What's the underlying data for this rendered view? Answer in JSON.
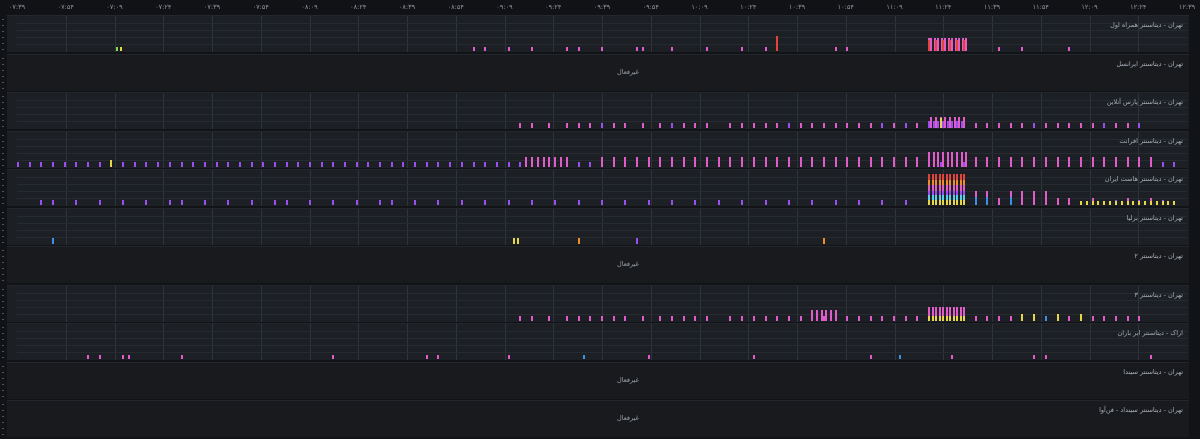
{
  "time_axis": {
    "ticks": [
      "۰۷:۳۹",
      "۰۷:۵۴",
      "۰۷:۰۹",
      "۰۷:۲۴",
      "۰۷:۳۹",
      "۰۷:۵۴",
      "۰۸:۰۹",
      "۰۸:۲۴",
      "۰۸:۳۹",
      "۰۸:۵۴",
      "۰۹:۰۹",
      "۰۹:۲۴",
      "۰۹:۳۹",
      "۰۹:۵۴",
      "۱۰:۰۹",
      "۱۰:۲۴",
      "۱۰:۳۹",
      "۱۰:۵۴",
      "۱۱:۰۹",
      "۱۱:۲۴",
      "۱۱:۳۹",
      "۱۱:۵۴",
      "۱۲:۰۹",
      "۱۲:۲۴",
      "۱۲:۳۹"
    ]
  },
  "colors": {
    "pink": "#e05cc8",
    "purple": "#9b4ff0",
    "red": "#e0443a",
    "orange": "#ef8a2d",
    "yellow": "#e7d64a",
    "green": "#7ed957",
    "blue": "#3f8fe6",
    "cyan": "#5ad0e8"
  },
  "panels": [
    {
      "title": "تهران - دیتاسنتر همراه اول",
      "status": "",
      "active": true,
      "series": [
        {
          "x": [
            0.085,
            0.088,
            0.39,
            0.4,
            0.42,
            0.44,
            0.47,
            0.48,
            0.5,
            0.53,
            0.535,
            0.56,
            0.59,
            0.62,
            0.64,
            0.7,
            0.71,
            0.84,
            0.86,
            0.9
          ],
          "h": 0.12,
          "color": "pink"
        },
        {
          "x": [
            0.085
          ],
          "h": 0.12,
          "color": "green"
        },
        {
          "x": [
            0.088
          ],
          "h": 0.12,
          "color": "yellow"
        },
        {
          "x": [
            0.65
          ],
          "h": 0.45,
          "color": "red"
        },
        {
          "x": [
            0.78,
            0.782,
            0.785,
            0.788,
            0.791,
            0.794,
            0.797,
            0.8,
            0.803,
            0.806,
            0.809,
            0.812
          ],
          "h": 0.38,
          "color": "pink"
        },
        {
          "x": [
            0.78,
            0.786,
            0.792,
            0.798,
            0.804,
            0.81
          ],
          "h": 0.32,
          "color": "red"
        }
      ]
    },
    {
      "title": "تهران - دیتاسنتر ایرانسل",
      "status": "غیرفعال",
      "active": false,
      "series": []
    },
    {
      "title": "تهران - دیتاسنتر پارس آنلاین",
      "status": "",
      "active": true,
      "series": [
        {
          "x": [
            0.43,
            0.44,
            0.455,
            0.47,
            0.48,
            0.49,
            0.5,
            0.51,
            0.52,
            0.535,
            0.55,
            0.56,
            0.57,
            0.58,
            0.59,
            0.61,
            0.62,
            0.63,
            0.64,
            0.65,
            0.66,
            0.67,
            0.68,
            0.69,
            0.7,
            0.71,
            0.72,
            0.73,
            0.74,
            0.75,
            0.76,
            0.77,
            0.78,
            0.79,
            0.8,
            0.82,
            0.83,
            0.84,
            0.85,
            0.86,
            0.87,
            0.88,
            0.89,
            0.9,
            0.91,
            0.92,
            0.93,
            0.94,
            0.95,
            0.96
          ],
          "h": 0.15,
          "color": "pink"
        },
        {
          "x": [
            0.5,
            0.56,
            0.66,
            0.74,
            0.76,
            0.87,
            0.93,
            0.96
          ],
          "h": 0.15,
          "color": "purple"
        },
        {
          "x": [
            0.782,
            0.786,
            0.79,
            0.794,
            0.798,
            0.802,
            0.806,
            0.81
          ],
          "h": 0.33,
          "color": "pink"
        },
        {
          "x": [
            0.78,
            0.784,
            0.788,
            0.792,
            0.796,
            0.8,
            0.804,
            0.808
          ],
          "h": 0.22,
          "color": "purple"
        },
        {
          "x": [
            0.79
          ],
          "h": 0.3,
          "color": "yellow"
        }
      ]
    },
    {
      "title": "تهران - دیتاسنتر افرانت",
      "status": "",
      "active": true,
      "series": [
        {
          "x": [
            0.0,
            0.01,
            0.02,
            0.03,
            0.04,
            0.05,
            0.06,
            0.07,
            0.08,
            0.09,
            0.1,
            0.11,
            0.12,
            0.13,
            0.14,
            0.15,
            0.16,
            0.17,
            0.18,
            0.19,
            0.2,
            0.21,
            0.22,
            0.23,
            0.24,
            0.25,
            0.26,
            0.27,
            0.28,
            0.29,
            0.3,
            0.31,
            0.32,
            0.33,
            0.34,
            0.35,
            0.36,
            0.37,
            0.38,
            0.39,
            0.4,
            0.41,
            0.42,
            0.43,
            0.44,
            0.45,
            0.46,
            0.47,
            0.48,
            0.49,
            0.5,
            0.51,
            0.52,
            0.53,
            0.54,
            0.55,
            0.56,
            0.57,
            0.58,
            0.59,
            0.6,
            0.61,
            0.62,
            0.63,
            0.64,
            0.65,
            0.66,
            0.67,
            0.68,
            0.69,
            0.7,
            0.71,
            0.72,
            0.73,
            0.74,
            0.75,
            0.76,
            0.77,
            0.78,
            0.79,
            0.8,
            0.81,
            0.82,
            0.83,
            0.84,
            0.85,
            0.86,
            0.87,
            0.88,
            0.89,
            0.9,
            0.91,
            0.92,
            0.93,
            0.94,
            0.95,
            0.96,
            0.97,
            0.98,
            0.99
          ],
          "h": 0.12,
          "color": "purple"
        },
        {
          "x": [
            0.435,
            0.44,
            0.445,
            0.45,
            0.455,
            0.46,
            0.465,
            0.47,
            0.5,
            0.51,
            0.52,
            0.53,
            0.54,
            0.55,
            0.56,
            0.57,
            0.58,
            0.59,
            0.6,
            0.61,
            0.62,
            0.63,
            0.64,
            0.65,
            0.66,
            0.67,
            0.68,
            0.69,
            0.7,
            0.71,
            0.72,
            0.73,
            0.74,
            0.75,
            0.76,
            0.77,
            0.82,
            0.83,
            0.84,
            0.85,
            0.86,
            0.87,
            0.88,
            0.89,
            0.9,
            0.91,
            0.92,
            0.93,
            0.94,
            0.95,
            0.96,
            0.97
          ],
          "h": 0.28,
          "color": "pink"
        },
        {
          "x": [
            0.78,
            0.784,
            0.788,
            0.792,
            0.796,
            0.8,
            0.804,
            0.808,
            0.812
          ],
          "h": 0.42,
          "color": "pink"
        },
        {
          "x": [
            0.08
          ],
          "h": 0.18,
          "color": "yellow"
        }
      ]
    },
    {
      "title": "تهران - دیتاسنتر هاست ایران",
      "status": "",
      "active": true,
      "series": [
        {
          "x": [
            0.02,
            0.03,
            0.05,
            0.07,
            0.09,
            0.11,
            0.13,
            0.14,
            0.16,
            0.18,
            0.2,
            0.22,
            0.23,
            0.25,
            0.27,
            0.29,
            0.31,
            0.32,
            0.34,
            0.36,
            0.38,
            0.4,
            0.42,
            0.44,
            0.46,
            0.48,
            0.5,
            0.52,
            0.54,
            0.56,
            0.58,
            0.6,
            0.62,
            0.64,
            0.66,
            0.68,
            0.7,
            0.72,
            0.74,
            0.76,
            0.82,
            0.84,
            0.86,
            0.88,
            0.9,
            0.92,
            0.94,
            0.96,
            0.98
          ],
          "h": 0.14,
          "color": "purple"
        },
        {
          "x": [
            0.84,
            0.86,
            0.87,
            0.89,
            0.9,
            0.92,
            0.95,
            0.97
          ],
          "h": 0.2,
          "color": "pink"
        },
        {
          "x": [
            0.78,
            0.783,
            0.786,
            0.789,
            0.792,
            0.795,
            0.798,
            0.801,
            0.804,
            0.807,
            0.81
          ],
          "h": 0.9,
          "color": "red"
        },
        {
          "x": [
            0.78,
            0.783,
            0.786,
            0.789,
            0.792,
            0.795,
            0.798,
            0.801,
            0.804,
            0.807,
            0.81
          ],
          "h": 0.75,
          "color": "orange"
        },
        {
          "x": [
            0.78,
            0.783,
            0.786,
            0.789,
            0.792,
            0.795,
            0.798,
            0.801,
            0.804,
            0.807,
            0.81
          ],
          "h": 0.6,
          "color": "pink"
        },
        {
          "x": [
            0.78,
            0.783,
            0.786,
            0.789,
            0.792,
            0.795,
            0.798,
            0.801,
            0.804,
            0.807,
            0.81
          ],
          "h": 0.42,
          "color": "purple"
        },
        {
          "x": [
            0.78,
            0.783,
            0.786,
            0.789,
            0.792,
            0.795,
            0.798,
            0.801,
            0.804,
            0.807,
            0.81
          ],
          "h": 0.28,
          "color": "cyan"
        },
        {
          "x": [
            0.78,
            0.783,
            0.786,
            0.789,
            0.792,
            0.795,
            0.798,
            0.801,
            0.804,
            0.807,
            0.81
          ],
          "h": 0.14,
          "color": "yellow"
        },
        {
          "x": [
            0.82,
            0.83,
            0.85,
            0.86,
            0.87,
            0.88
          ],
          "h": 0.4,
          "color": "pink"
        },
        {
          "x": [
            0.82,
            0.83,
            0.85
          ],
          "h": 0.25,
          "color": "blue"
        },
        {
          "x": [
            0.91,
            0.915,
            0.92,
            0.925,
            0.93,
            0.935,
            0.94,
            0.945,
            0.95,
            0.955,
            0.96,
            0.965,
            0.97,
            0.975,
            0.98,
            0.985,
            0.99
          ],
          "h": 0.12,
          "color": "yellow"
        }
      ]
    },
    {
      "title": "تهران - دیتاسنتر برلیا",
      "status": "",
      "active": true,
      "series": [
        {
          "x": [
            0.03
          ],
          "h": 0.15,
          "color": "blue"
        },
        {
          "x": [
            0.425,
            0.428
          ],
          "h": 0.15,
          "color": "yellow"
        },
        {
          "x": [
            0.48,
            0.69
          ],
          "h": 0.15,
          "color": "orange"
        },
        {
          "x": [
            0.53
          ],
          "h": 0.15,
          "color": "purple"
        }
      ]
    },
    {
      "title": "تهران - دیتاسنتر ۲",
      "status": "غیرفعال",
      "active": false,
      "series": []
    },
    {
      "title": "تهران - دیتاسنتر ۳",
      "status": "",
      "active": true,
      "series": [
        {
          "x": [
            0.43,
            0.44,
            0.455,
            0.47,
            0.48,
            0.49,
            0.5,
            0.51,
            0.52,
            0.535,
            0.55,
            0.56,
            0.57,
            0.58,
            0.59,
            0.61,
            0.62,
            0.63,
            0.64,
            0.65,
            0.66,
            0.67,
            0.68,
            0.69,
            0.7,
            0.71,
            0.72,
            0.73,
            0.74,
            0.75,
            0.76,
            0.77,
            0.82,
            0.83,
            0.84,
            0.85,
            0.86,
            0.87,
            0.88,
            0.89,
            0.9,
            0.91,
            0.92,
            0.93,
            0.94,
            0.95,
            0.96
          ],
          "h": 0.14,
          "color": "pink"
        },
        {
          "x": [
            0.68,
            0.684,
            0.688,
            0.692,
            0.696,
            0.7
          ],
          "h": 0.3,
          "color": "pink"
        },
        {
          "x": [
            0.78,
            0.783,
            0.786,
            0.789,
            0.792,
            0.795,
            0.798,
            0.801,
            0.804,
            0.807,
            0.81
          ],
          "h": 0.4,
          "color": "pink"
        },
        {
          "x": [
            0.78,
            0.783,
            0.786,
            0.789,
            0.792,
            0.795,
            0.798,
            0.801,
            0.804,
            0.807,
            0.81
          ],
          "h": 0.14,
          "color": "yellow"
        },
        {
          "x": [
            0.86,
            0.87,
            0.89,
            0.91
          ],
          "h": 0.2,
          "color": "yellow"
        },
        {
          "x": [
            0.88
          ],
          "h": 0.14,
          "color": "blue"
        }
      ]
    },
    {
      "title": "اراک - دیتاسنتر ابر باران",
      "status": "",
      "active": true,
      "series": [
        {
          "x": [
            0.06,
            0.07,
            0.09,
            0.095,
            0.14,
            0.27,
            0.35,
            0.36,
            0.42,
            0.54,
            0.63,
            0.73,
            0.8,
            0.87,
            0.88,
            0.97
          ],
          "h": 0.12,
          "color": "pink"
        },
        {
          "x": [
            0.485,
            0.755
          ],
          "h": 0.12,
          "color": "blue"
        }
      ]
    },
    {
      "title": "تهران - دیتاسنتر سیندا",
      "status": "غیرفعال",
      "active": false,
      "series": []
    },
    {
      "title": "تهران - دیتاسنتر سینداد - فن‌آوا",
      "status": "غیرفعال",
      "active": false,
      "series": []
    }
  ]
}
